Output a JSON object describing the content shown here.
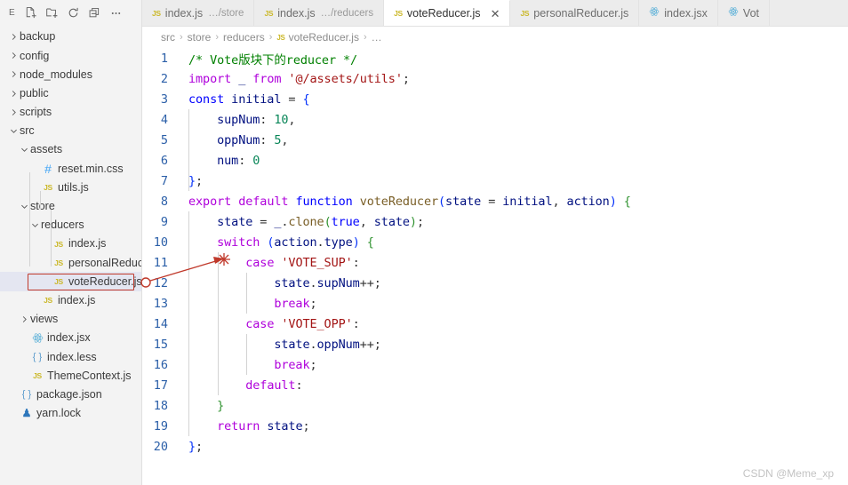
{
  "sidebar": {
    "toolbar": {
      "title": "E",
      "icons": [
        {
          "name": "new-file-icon",
          "label": "New File"
        },
        {
          "name": "new-folder-icon",
          "label": "New Folder"
        },
        {
          "name": "refresh-icon",
          "label": "Refresh Explorer"
        },
        {
          "name": "collapse-all-icon",
          "label": "Collapse Folders"
        },
        {
          "name": "more-actions-icon",
          "label": "…"
        }
      ]
    },
    "tree": [
      {
        "label": "backup",
        "depth": 0,
        "type": "folder",
        "expanded": false,
        "icon": "chevron-right-icon",
        "selected": false
      },
      {
        "label": "config",
        "depth": 0,
        "type": "folder",
        "expanded": false,
        "icon": "chevron-right-icon",
        "selected": false
      },
      {
        "label": "node_modules",
        "depth": 0,
        "type": "folder",
        "expanded": false,
        "icon": "chevron-right-icon",
        "selected": false
      },
      {
        "label": "public",
        "depth": 0,
        "type": "folder",
        "expanded": false,
        "icon": "chevron-right-icon",
        "selected": false
      },
      {
        "label": "scripts",
        "depth": 0,
        "type": "folder",
        "expanded": false,
        "icon": "chevron-right-icon",
        "selected": false
      },
      {
        "label": "src",
        "depth": 0,
        "type": "folder",
        "expanded": true,
        "icon": "chevron-down-icon",
        "selected": false
      },
      {
        "label": "assets",
        "depth": 1,
        "type": "folder",
        "expanded": true,
        "icon": "chevron-down-icon",
        "selected": false
      },
      {
        "label": "reset.min.css",
        "depth": 2,
        "type": "file",
        "filetype": "css",
        "icon": "css-file-icon",
        "selected": false
      },
      {
        "label": "utils.js",
        "depth": 2,
        "type": "file",
        "filetype": "js",
        "icon": "js-file-icon",
        "selected": false
      },
      {
        "label": "store",
        "depth": 1,
        "type": "folder",
        "expanded": true,
        "icon": "chevron-down-icon",
        "selected": false
      },
      {
        "label": "reducers",
        "depth": 2,
        "type": "folder",
        "expanded": true,
        "icon": "chevron-down-icon",
        "selected": false
      },
      {
        "label": "index.js",
        "depth": 3,
        "type": "file",
        "filetype": "js",
        "icon": "js-file-icon",
        "selected": false
      },
      {
        "label": "personalReduce…",
        "depth": 3,
        "type": "file",
        "filetype": "js",
        "icon": "js-file-icon",
        "selected": false
      },
      {
        "label": "voteReducer.js",
        "depth": 3,
        "type": "file",
        "filetype": "js",
        "icon": "js-file-icon",
        "selected": true
      },
      {
        "label": "index.js",
        "depth": 2,
        "type": "file",
        "filetype": "js",
        "icon": "js-file-icon",
        "selected": false
      },
      {
        "label": "views",
        "depth": 1,
        "type": "folder",
        "expanded": false,
        "icon": "chevron-right-icon",
        "selected": false
      },
      {
        "label": "index.jsx",
        "depth": 1,
        "type": "file",
        "filetype": "react",
        "icon": "react-file-icon",
        "selected": false
      },
      {
        "label": "index.less",
        "depth": 1,
        "type": "file",
        "filetype": "json",
        "icon": "less-file-icon",
        "selected": false
      },
      {
        "label": "ThemeContext.js",
        "depth": 1,
        "type": "file",
        "filetype": "js",
        "icon": "js-file-icon",
        "selected": false
      },
      {
        "label": "package.json",
        "depth": 0,
        "type": "file",
        "filetype": "json",
        "icon": "json-file-icon",
        "selected": false
      },
      {
        "label": "yarn.lock",
        "depth": 0,
        "type": "file",
        "filetype": "yarn",
        "icon": "yarn-file-icon",
        "selected": false
      }
    ]
  },
  "tabs": [
    {
      "name": "index.js",
      "desc": "…/store",
      "icon": "js",
      "active": false,
      "closable": false
    },
    {
      "name": "index.js",
      "desc": "…/reducers",
      "icon": "js",
      "active": false,
      "closable": false
    },
    {
      "name": "voteReducer.js",
      "desc": "",
      "icon": "js",
      "active": true,
      "closable": true
    },
    {
      "name": "personalReducer.js",
      "desc": "",
      "icon": "js",
      "active": false,
      "closable": false
    },
    {
      "name": "index.jsx",
      "desc": "",
      "icon": "react",
      "active": false,
      "closable": false
    },
    {
      "name": "Vot",
      "desc": "",
      "icon": "react",
      "active": false,
      "closable": false
    }
  ],
  "breadcrumb": [
    {
      "label": "src",
      "icon": ""
    },
    {
      "label": "store",
      "icon": ""
    },
    {
      "label": "reducers",
      "icon": ""
    },
    {
      "label": "voteReducer.js",
      "icon": "js"
    },
    {
      "label": "…",
      "icon": ""
    }
  ],
  "editor": {
    "filename": "voteReducer.js",
    "lines": [
      {
        "num": "1",
        "tokens": [
          {
            "t": "/* Vote版块下的reducer */",
            "c": "t-com"
          }
        ]
      },
      {
        "num": "2",
        "tokens": [
          {
            "t": "import",
            "c": "t-kw"
          },
          {
            "t": " ",
            "c": "t-plain"
          },
          {
            "t": "_",
            "c": "t-var"
          },
          {
            "t": " ",
            "c": "t-plain"
          },
          {
            "t": "from",
            "c": "t-kw"
          },
          {
            "t": " ",
            "c": "t-plain"
          },
          {
            "t": "'@/assets/utils'",
            "c": "t-str"
          },
          {
            "t": ";",
            "c": "t-plain"
          }
        ]
      },
      {
        "num": "3",
        "tokens": [
          {
            "t": "const",
            "c": "t-kw2"
          },
          {
            "t": " ",
            "c": "t-plain"
          },
          {
            "t": "initial",
            "c": "t-var"
          },
          {
            "t": " = ",
            "c": "t-plain"
          },
          {
            "t": "{",
            "c": "t-br"
          }
        ]
      },
      {
        "num": "4",
        "tokens": [
          {
            "t": "    ",
            "c": "t-plain"
          },
          {
            "t": "supNum",
            "c": "t-var"
          },
          {
            "t": ": ",
            "c": "t-plain"
          },
          {
            "t": "10",
            "c": "t-num"
          },
          {
            "t": ",",
            "c": "t-plain"
          }
        ]
      },
      {
        "num": "5",
        "tokens": [
          {
            "t": "    ",
            "c": "t-plain"
          },
          {
            "t": "oppNum",
            "c": "t-var"
          },
          {
            "t": ": ",
            "c": "t-plain"
          },
          {
            "t": "5",
            "c": "t-num"
          },
          {
            "t": ",",
            "c": "t-plain"
          }
        ]
      },
      {
        "num": "6",
        "tokens": [
          {
            "t": "    ",
            "c": "t-plain"
          },
          {
            "t": "num",
            "c": "t-var"
          },
          {
            "t": ": ",
            "c": "t-plain"
          },
          {
            "t": "0",
            "c": "t-num"
          }
        ]
      },
      {
        "num": "7",
        "tokens": [
          {
            "t": "}",
            "c": "t-br"
          },
          {
            "t": ";",
            "c": "t-plain"
          }
        ]
      },
      {
        "num": "8",
        "tokens": [
          {
            "t": "export",
            "c": "t-kw"
          },
          {
            "t": " ",
            "c": "t-plain"
          },
          {
            "t": "default",
            "c": "t-kw"
          },
          {
            "t": " ",
            "c": "t-plain"
          },
          {
            "t": "function",
            "c": "t-kw2"
          },
          {
            "t": " ",
            "c": "t-plain"
          },
          {
            "t": "voteReducer",
            "c": "t-fn"
          },
          {
            "t": "(",
            "c": "t-br"
          },
          {
            "t": "state",
            "c": "t-var"
          },
          {
            "t": " = ",
            "c": "t-plain"
          },
          {
            "t": "initial",
            "c": "t-var"
          },
          {
            "t": ", ",
            "c": "t-plain"
          },
          {
            "t": "action",
            "c": "t-var"
          },
          {
            "t": ")",
            "c": "t-br"
          },
          {
            "t": " ",
            "c": "t-plain"
          },
          {
            "t": "{",
            "c": "t-br2"
          }
        ]
      },
      {
        "num": "9",
        "tokens": [
          {
            "t": "    ",
            "c": "t-plain"
          },
          {
            "t": "state",
            "c": "t-var"
          },
          {
            "t": " = ",
            "c": "t-plain"
          },
          {
            "t": "_",
            "c": "t-var"
          },
          {
            "t": ".",
            "c": "t-plain"
          },
          {
            "t": "clone",
            "c": "t-fn"
          },
          {
            "t": "(",
            "c": "t-br2"
          },
          {
            "t": "true",
            "c": "t-kw2"
          },
          {
            "t": ", ",
            "c": "t-plain"
          },
          {
            "t": "state",
            "c": "t-var"
          },
          {
            "t": ")",
            "c": "t-br2"
          },
          {
            "t": ";",
            "c": "t-plain"
          }
        ]
      },
      {
        "num": "10",
        "tokens": [
          {
            "t": "    ",
            "c": "t-plain"
          },
          {
            "t": "switch",
            "c": "t-kw"
          },
          {
            "t": " ",
            "c": "t-plain"
          },
          {
            "t": "(",
            "c": "t-br"
          },
          {
            "t": "action",
            "c": "t-var"
          },
          {
            "t": ".",
            "c": "t-plain"
          },
          {
            "t": "type",
            "c": "t-var"
          },
          {
            "t": ")",
            "c": "t-br"
          },
          {
            "t": " ",
            "c": "t-plain"
          },
          {
            "t": "{",
            "c": "t-br2"
          }
        ]
      },
      {
        "num": "11",
        "tokens": [
          {
            "t": "        ",
            "c": "t-plain"
          },
          {
            "t": "case",
            "c": "t-kw"
          },
          {
            "t": " ",
            "c": "t-plain"
          },
          {
            "t": "'VOTE_SUP'",
            "c": "t-str"
          },
          {
            "t": ":",
            "c": "t-plain"
          }
        ]
      },
      {
        "num": "12",
        "tokens": [
          {
            "t": "            ",
            "c": "t-plain"
          },
          {
            "t": "state",
            "c": "t-var"
          },
          {
            "t": ".",
            "c": "t-plain"
          },
          {
            "t": "supNum",
            "c": "t-var"
          },
          {
            "t": "++;",
            "c": "t-plain"
          }
        ]
      },
      {
        "num": "13",
        "tokens": [
          {
            "t": "            ",
            "c": "t-plain"
          },
          {
            "t": "break",
            "c": "t-kw"
          },
          {
            "t": ";",
            "c": "t-plain"
          }
        ]
      },
      {
        "num": "14",
        "tokens": [
          {
            "t": "        ",
            "c": "t-plain"
          },
          {
            "t": "case",
            "c": "t-kw"
          },
          {
            "t": " ",
            "c": "t-plain"
          },
          {
            "t": "'VOTE_OPP'",
            "c": "t-str"
          },
          {
            "t": ":",
            "c": "t-plain"
          }
        ]
      },
      {
        "num": "15",
        "tokens": [
          {
            "t": "            ",
            "c": "t-plain"
          },
          {
            "t": "state",
            "c": "t-var"
          },
          {
            "t": ".",
            "c": "t-plain"
          },
          {
            "t": "oppNum",
            "c": "t-var"
          },
          {
            "t": "++;",
            "c": "t-plain"
          }
        ]
      },
      {
        "num": "16",
        "tokens": [
          {
            "t": "            ",
            "c": "t-plain"
          },
          {
            "t": "break",
            "c": "t-kw"
          },
          {
            "t": ";",
            "c": "t-plain"
          }
        ]
      },
      {
        "num": "17",
        "tokens": [
          {
            "t": "        ",
            "c": "t-plain"
          },
          {
            "t": "default",
            "c": "t-kw"
          },
          {
            "t": ":",
            "c": "t-plain"
          }
        ]
      },
      {
        "num": "18",
        "tokens": [
          {
            "t": "    ",
            "c": "t-plain"
          },
          {
            "t": "}",
            "c": "t-br2"
          }
        ]
      },
      {
        "num": "19",
        "tokens": [
          {
            "t": "    ",
            "c": "t-plain"
          },
          {
            "t": "return",
            "c": "t-kw"
          },
          {
            "t": " ",
            "c": "t-plain"
          },
          {
            "t": "state",
            "c": "t-var"
          },
          {
            "t": ";",
            "c": "t-plain"
          }
        ]
      },
      {
        "num": "20",
        "tokens": [
          {
            "t": "}",
            "c": "t-br"
          },
          {
            "t": ";",
            "c": "t-plain"
          }
        ]
      }
    ]
  },
  "annotation": {
    "color": "#c0392b",
    "target_label": "voteReducer.js",
    "shape": "circle-and-arrow"
  },
  "watermark": "CSDN @Meme_xp",
  "colors": {
    "sidebar_bg": "#f3f3f3",
    "tab_inactive_bg": "#ececec",
    "tab_active_bg": "#ffffff",
    "selection_bg": "#e4e6f1",
    "line_number": "#2b5fa8",
    "annotation_red": "#c0392b",
    "comment_green": "#008000",
    "keyword_purple": "#af00db",
    "keyword_blue": "#0000ff",
    "string_red": "#a31515",
    "variable_navy": "#001080",
    "number_green": "#098658",
    "function_brown": "#795e26"
  }
}
